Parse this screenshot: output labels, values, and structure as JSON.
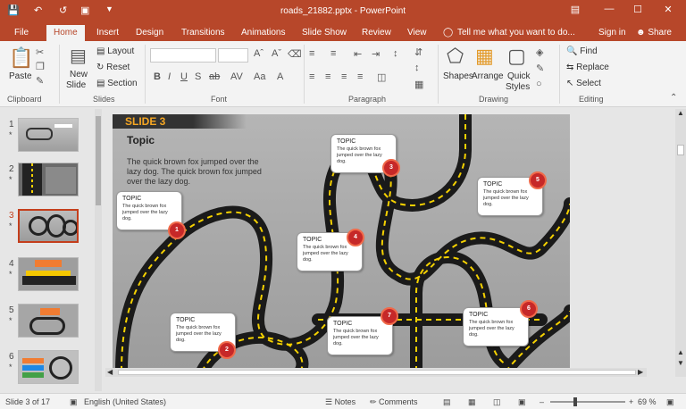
{
  "app": {
    "window_title": "roads_21882.pptx - PowerPoint",
    "accent": "#b7472a"
  },
  "tabs": [
    "File",
    "Home",
    "Insert",
    "Design",
    "Transitions",
    "Animations",
    "Slide Show",
    "Review",
    "View"
  ],
  "tell_me": "Tell me what you want to do...",
  "sign_in": "Sign in",
  "share": "Share",
  "ribbon": {
    "clipboard": {
      "paste": "Paste",
      "label": "Clipboard"
    },
    "slides": {
      "new_slide": "New",
      "new_slide2": "Slide",
      "layout": "Layout",
      "reset": "Reset",
      "section": "Section",
      "label": "Slides"
    },
    "font": {
      "label": "Font"
    },
    "paragraph": {
      "label": "Paragraph"
    },
    "drawing": {
      "shapes": "Shapes",
      "arrange": "Arrange",
      "quick_styles": "Quick",
      "quick_styles2": "Styles",
      "label": "Drawing"
    },
    "editing": {
      "find": "Find",
      "replace": "Replace",
      "select": "Select",
      "label": "Editing"
    }
  },
  "thumbnails": [
    {
      "num": "1",
      "star": "*"
    },
    {
      "num": "2",
      "star": "*"
    },
    {
      "num": "3",
      "star": "*"
    },
    {
      "num": "4",
      "star": "*"
    },
    {
      "num": "5",
      "star": "*"
    },
    {
      "num": "6",
      "star": "*"
    }
  ],
  "slide": {
    "banner": "SLIDE 3",
    "topic": "Topic",
    "body": "The quick brown fox jumped over the lazy dog. The quick brown fox jumped over the lazy dog.",
    "callouts": [
      {
        "title": "TOPIC",
        "body": "The quick brown fox jumped over the lazy dog."
      },
      {
        "title": "TOPIC",
        "body": "The quick brown fox jumped over the lazy dog."
      },
      {
        "title": "TOPIC",
        "body": "The quick brown fox jumped over the lazy dog."
      },
      {
        "title": "TOPIC",
        "body": "The quick brown fox jumped over the lazy dog."
      },
      {
        "title": "TOPIC",
        "body": "The quick brown fox jumped over the lazy dog."
      },
      {
        "title": "TOPIC",
        "body": "The quick brown fox jumped over the lazy dog."
      },
      {
        "title": "TOPIC",
        "body": "The quick brown fox jumped over the lazy dog."
      }
    ],
    "pins": [
      "1",
      "2",
      "3",
      "4",
      "5",
      "6",
      "7"
    ]
  },
  "status": {
    "slide_count": "Slide 3 of 17",
    "language": "English (United States)",
    "notes": "Notes",
    "comments": "Comments",
    "zoom": "69 %",
    "zoom_fraction": 0.69
  }
}
